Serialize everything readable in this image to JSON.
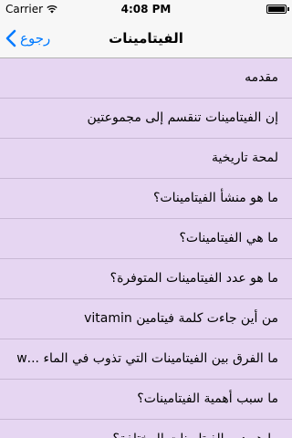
{
  "status_bar": {
    "carrier": "Carrier",
    "time": "4:08 PM"
  },
  "nav": {
    "back_label": "رجوع",
    "title": "الفيتامينات"
  },
  "items": [
    {
      "label": "مقدمه"
    },
    {
      "label": "إن الفيتامينات تنقسم إلى مجموعتين"
    },
    {
      "label": "لمحة تاريخية"
    },
    {
      "label": "ما هو منشأ الفيتامينات؟"
    },
    {
      "label": "ما هي الفيتامينات؟"
    },
    {
      "label": "ما هو عدد الفيتامينات المتوفرة؟"
    },
    {
      "label": "من أين جاءت كلمة فيتامين vitamin"
    },
    {
      "label": "ما الفرق بين الفيتامينات التي تذوب في الماء ...w"
    },
    {
      "label": "ما سبب أهمية الفيتامينات؟"
    },
    {
      "label": "ما هو دور الفيتامينات المختلفة؟"
    }
  ]
}
